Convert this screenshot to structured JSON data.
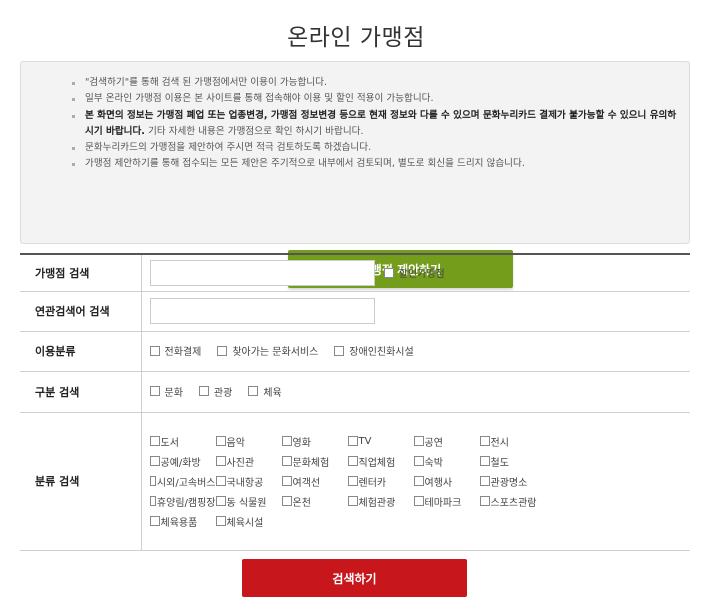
{
  "page": {
    "title": "온라인 가맹점"
  },
  "notice": {
    "items": [
      {
        "parts": [
          {
            "text": "\"검색하기\"를 통해 검색 된 가맹점에서만 이용이 가능합니다.",
            "bold": false
          }
        ]
      },
      {
        "parts": [
          {
            "text": "일부 온라인 가맹점 이용은 본 사이트를 통해 접속해야 이용 및 할인 적용이 가능합니다.",
            "bold": false
          }
        ]
      },
      {
        "parts": [
          {
            "text": "본 화면의 정보는 가맹점 폐업 또는 업종변경, 가맹점 정보변경 등으로 현재 정보와 다를 수 있으며 문화누리카드 결제가 불가능할 수 있으니 유의하시기 바랍니다.",
            "bold": true
          },
          {
            "text": " 기타 자세한 내용은 가맹점으로 확인 하시기 바랍니다.",
            "bold": false
          }
        ]
      },
      {
        "parts": [
          {
            "text": "문화누리카드의 가맹점을 제안하여 주시면 적극 검토하도록 하겠습니다.",
            "bold": false
          }
        ]
      },
      {
        "parts": [
          {
            "text": "가맹점 제안하기를 통해 접수되는 모든 제안은 주기적으로 내부에서 검토되며, 별도로 회신을 드리지 않습니다.",
            "bold": false
          }
        ]
      }
    ],
    "propose_label": "가맹점 제안하기"
  },
  "form": {
    "store_search": {
      "label": "가맹점 검색",
      "value": "",
      "discount_label": "할인가맹점"
    },
    "related_search": {
      "label": "연관검색어 검색",
      "value": ""
    },
    "usage": {
      "label": "이용분류",
      "options": [
        "전화결제",
        "찾아가는 문화서비스",
        "장애인친화시설"
      ]
    },
    "division": {
      "label": "구분 검색",
      "options": [
        "문화",
        "관광",
        "체육"
      ]
    },
    "category": {
      "label": "분류 검색",
      "options": [
        "도서",
        "음악",
        "영화",
        "TV",
        "공연",
        "전시",
        "공예/화방",
        "사진관",
        "문화체험",
        "직업체험",
        "숙박",
        "철도",
        "시외/고속버스",
        "국내항공",
        "여객선",
        "렌터카",
        "여행사",
        "관광명소",
        "휴양림/캠핑장",
        "동 식물원",
        "온천",
        "체험관광",
        "테마파크",
        "스포츠관람",
        "체육용품",
        "체육시설"
      ]
    }
  },
  "search_label": "검색하기"
}
